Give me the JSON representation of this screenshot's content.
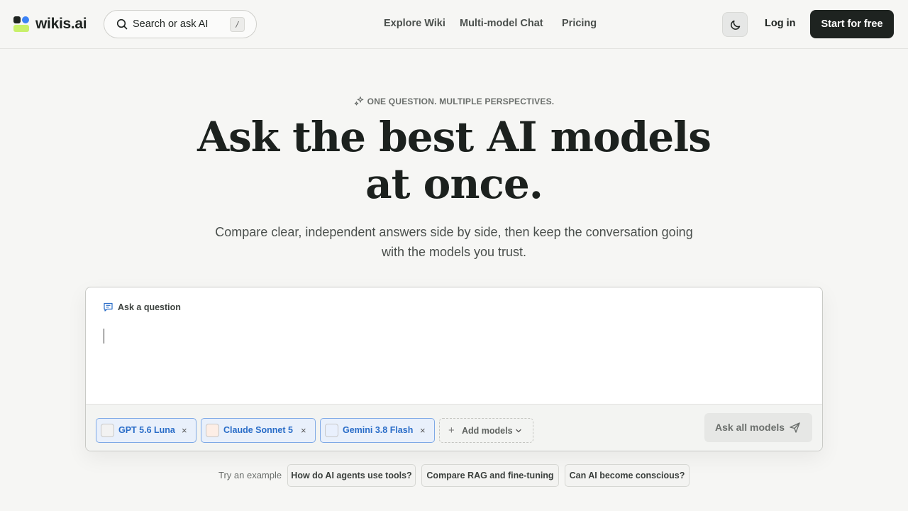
{
  "header": {
    "logo_text": "wikis.ai",
    "search_placeholder": "Search or ask AI",
    "search_shortcut": "/",
    "nav": [
      "Explore Wiki",
      "Multi-model Chat",
      "Pricing"
    ],
    "login_label": "Log in",
    "cta_label": "Start for free"
  },
  "hero": {
    "eyebrow": "ONE QUESTION. MULTIPLE PERSPECTIVES.",
    "title": "Ask the best AI models at once.",
    "subtitle": "Compare clear, independent answers side by side, then keep the conversation going with the models you trust."
  },
  "ask_card": {
    "label": "Ask a question",
    "input_value": "",
    "models": [
      {
        "name": "GPT 5.6 Luna",
        "color": "#f2f2f2"
      },
      {
        "name": "Claude Sonnet 5",
        "color": "#fdeee6"
      },
      {
        "name": "Gemini 3.8 Flash",
        "color": "#e9f0fd"
      }
    ],
    "remove_symbol": "×",
    "add_models_label": "Add models",
    "submit_label": "Ask all models"
  },
  "examples": {
    "label": "Try an example",
    "items": [
      "How do AI agents use tools?",
      "Compare RAG and fine-tuning",
      "Can AI become conscious?"
    ]
  },
  "colors": {
    "background": "#f6f6f4",
    "primary_dark": "#1e2320",
    "accent_blue": "#2a6dc8",
    "logo_green": "#c8f06a"
  }
}
